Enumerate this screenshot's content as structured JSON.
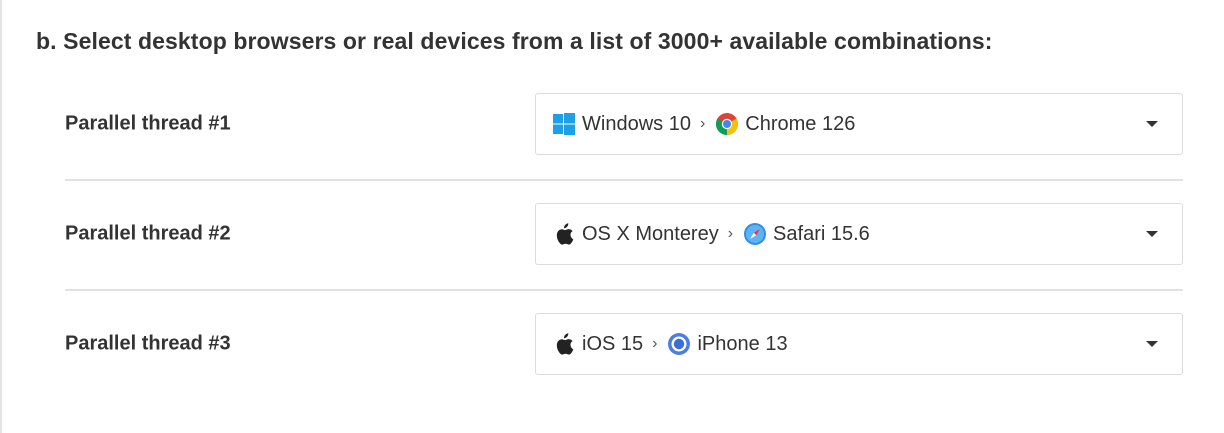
{
  "heading": "b. Select desktop browsers or real devices from a list of 3000+ available combinations:",
  "threads": [
    {
      "label": "Parallel thread #1",
      "os": "Windows 10",
      "os_icon": "windows-icon",
      "browser": "Chrome 126",
      "browser_icon": "chrome-icon"
    },
    {
      "label": "Parallel thread #2",
      "os": "OS X Monterey",
      "os_icon": "apple-icon",
      "browser": "Safari 15.6",
      "browser_icon": "safari-icon"
    },
    {
      "label": "Parallel thread #3",
      "os": "iOS 15",
      "os_icon": "apple-icon",
      "browser": "iPhone 13",
      "browser_icon": "device-icon"
    }
  ],
  "separator": "›",
  "colors": {
    "windows_blue": "#1ea0e8",
    "apple_black": "#222222",
    "border": "#dcdcdc",
    "divider": "#e1e1e1",
    "text": "#333333"
  }
}
